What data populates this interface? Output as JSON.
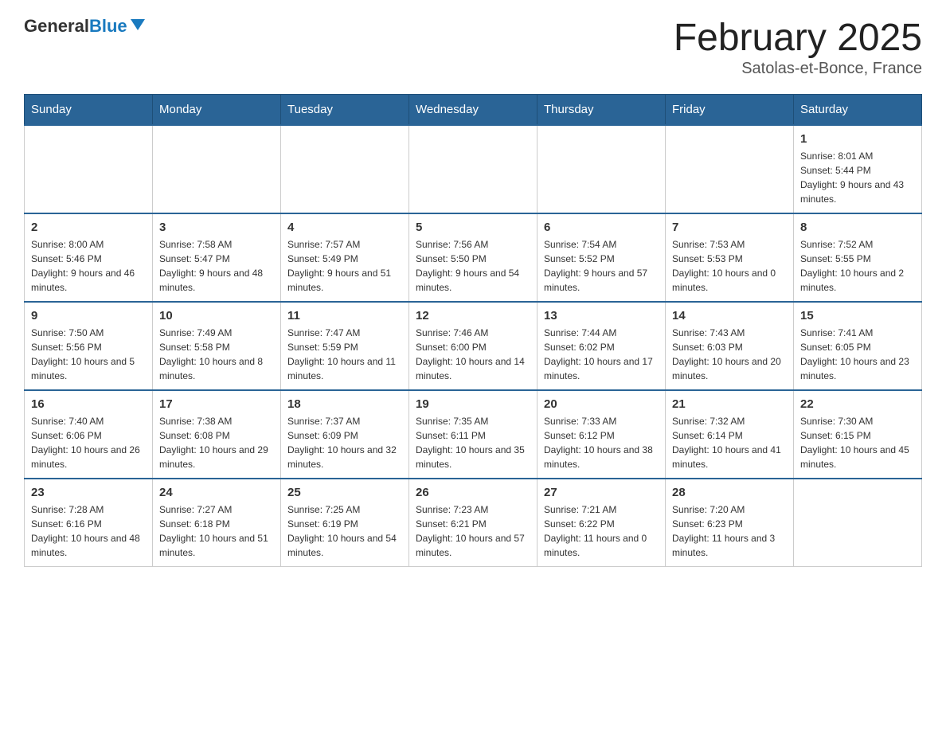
{
  "header": {
    "logo_text_black": "General",
    "logo_text_blue": "Blue",
    "month_title": "February 2025",
    "location": "Satolas-et-Bonce, France"
  },
  "weekdays": [
    "Sunday",
    "Monday",
    "Tuesday",
    "Wednesday",
    "Thursday",
    "Friday",
    "Saturday"
  ],
  "weeks": [
    [
      {
        "day": "",
        "info": ""
      },
      {
        "day": "",
        "info": ""
      },
      {
        "day": "",
        "info": ""
      },
      {
        "day": "",
        "info": ""
      },
      {
        "day": "",
        "info": ""
      },
      {
        "day": "",
        "info": ""
      },
      {
        "day": "1",
        "info": "Sunrise: 8:01 AM\nSunset: 5:44 PM\nDaylight: 9 hours and 43 minutes."
      }
    ],
    [
      {
        "day": "2",
        "info": "Sunrise: 8:00 AM\nSunset: 5:46 PM\nDaylight: 9 hours and 46 minutes."
      },
      {
        "day": "3",
        "info": "Sunrise: 7:58 AM\nSunset: 5:47 PM\nDaylight: 9 hours and 48 minutes."
      },
      {
        "day": "4",
        "info": "Sunrise: 7:57 AM\nSunset: 5:49 PM\nDaylight: 9 hours and 51 minutes."
      },
      {
        "day": "5",
        "info": "Sunrise: 7:56 AM\nSunset: 5:50 PM\nDaylight: 9 hours and 54 minutes."
      },
      {
        "day": "6",
        "info": "Sunrise: 7:54 AM\nSunset: 5:52 PM\nDaylight: 9 hours and 57 minutes."
      },
      {
        "day": "7",
        "info": "Sunrise: 7:53 AM\nSunset: 5:53 PM\nDaylight: 10 hours and 0 minutes."
      },
      {
        "day": "8",
        "info": "Sunrise: 7:52 AM\nSunset: 5:55 PM\nDaylight: 10 hours and 2 minutes."
      }
    ],
    [
      {
        "day": "9",
        "info": "Sunrise: 7:50 AM\nSunset: 5:56 PM\nDaylight: 10 hours and 5 minutes."
      },
      {
        "day": "10",
        "info": "Sunrise: 7:49 AM\nSunset: 5:58 PM\nDaylight: 10 hours and 8 minutes."
      },
      {
        "day": "11",
        "info": "Sunrise: 7:47 AM\nSunset: 5:59 PM\nDaylight: 10 hours and 11 minutes."
      },
      {
        "day": "12",
        "info": "Sunrise: 7:46 AM\nSunset: 6:00 PM\nDaylight: 10 hours and 14 minutes."
      },
      {
        "day": "13",
        "info": "Sunrise: 7:44 AM\nSunset: 6:02 PM\nDaylight: 10 hours and 17 minutes."
      },
      {
        "day": "14",
        "info": "Sunrise: 7:43 AM\nSunset: 6:03 PM\nDaylight: 10 hours and 20 minutes."
      },
      {
        "day": "15",
        "info": "Sunrise: 7:41 AM\nSunset: 6:05 PM\nDaylight: 10 hours and 23 minutes."
      }
    ],
    [
      {
        "day": "16",
        "info": "Sunrise: 7:40 AM\nSunset: 6:06 PM\nDaylight: 10 hours and 26 minutes."
      },
      {
        "day": "17",
        "info": "Sunrise: 7:38 AM\nSunset: 6:08 PM\nDaylight: 10 hours and 29 minutes."
      },
      {
        "day": "18",
        "info": "Sunrise: 7:37 AM\nSunset: 6:09 PM\nDaylight: 10 hours and 32 minutes."
      },
      {
        "day": "19",
        "info": "Sunrise: 7:35 AM\nSunset: 6:11 PM\nDaylight: 10 hours and 35 minutes."
      },
      {
        "day": "20",
        "info": "Sunrise: 7:33 AM\nSunset: 6:12 PM\nDaylight: 10 hours and 38 minutes."
      },
      {
        "day": "21",
        "info": "Sunrise: 7:32 AM\nSunset: 6:14 PM\nDaylight: 10 hours and 41 minutes."
      },
      {
        "day": "22",
        "info": "Sunrise: 7:30 AM\nSunset: 6:15 PM\nDaylight: 10 hours and 45 minutes."
      }
    ],
    [
      {
        "day": "23",
        "info": "Sunrise: 7:28 AM\nSunset: 6:16 PM\nDaylight: 10 hours and 48 minutes."
      },
      {
        "day": "24",
        "info": "Sunrise: 7:27 AM\nSunset: 6:18 PM\nDaylight: 10 hours and 51 minutes."
      },
      {
        "day": "25",
        "info": "Sunrise: 7:25 AM\nSunset: 6:19 PM\nDaylight: 10 hours and 54 minutes."
      },
      {
        "day": "26",
        "info": "Sunrise: 7:23 AM\nSunset: 6:21 PM\nDaylight: 10 hours and 57 minutes."
      },
      {
        "day": "27",
        "info": "Sunrise: 7:21 AM\nSunset: 6:22 PM\nDaylight: 11 hours and 0 minutes."
      },
      {
        "day": "28",
        "info": "Sunrise: 7:20 AM\nSunset: 6:23 PM\nDaylight: 11 hours and 3 minutes."
      },
      {
        "day": "",
        "info": ""
      }
    ]
  ]
}
